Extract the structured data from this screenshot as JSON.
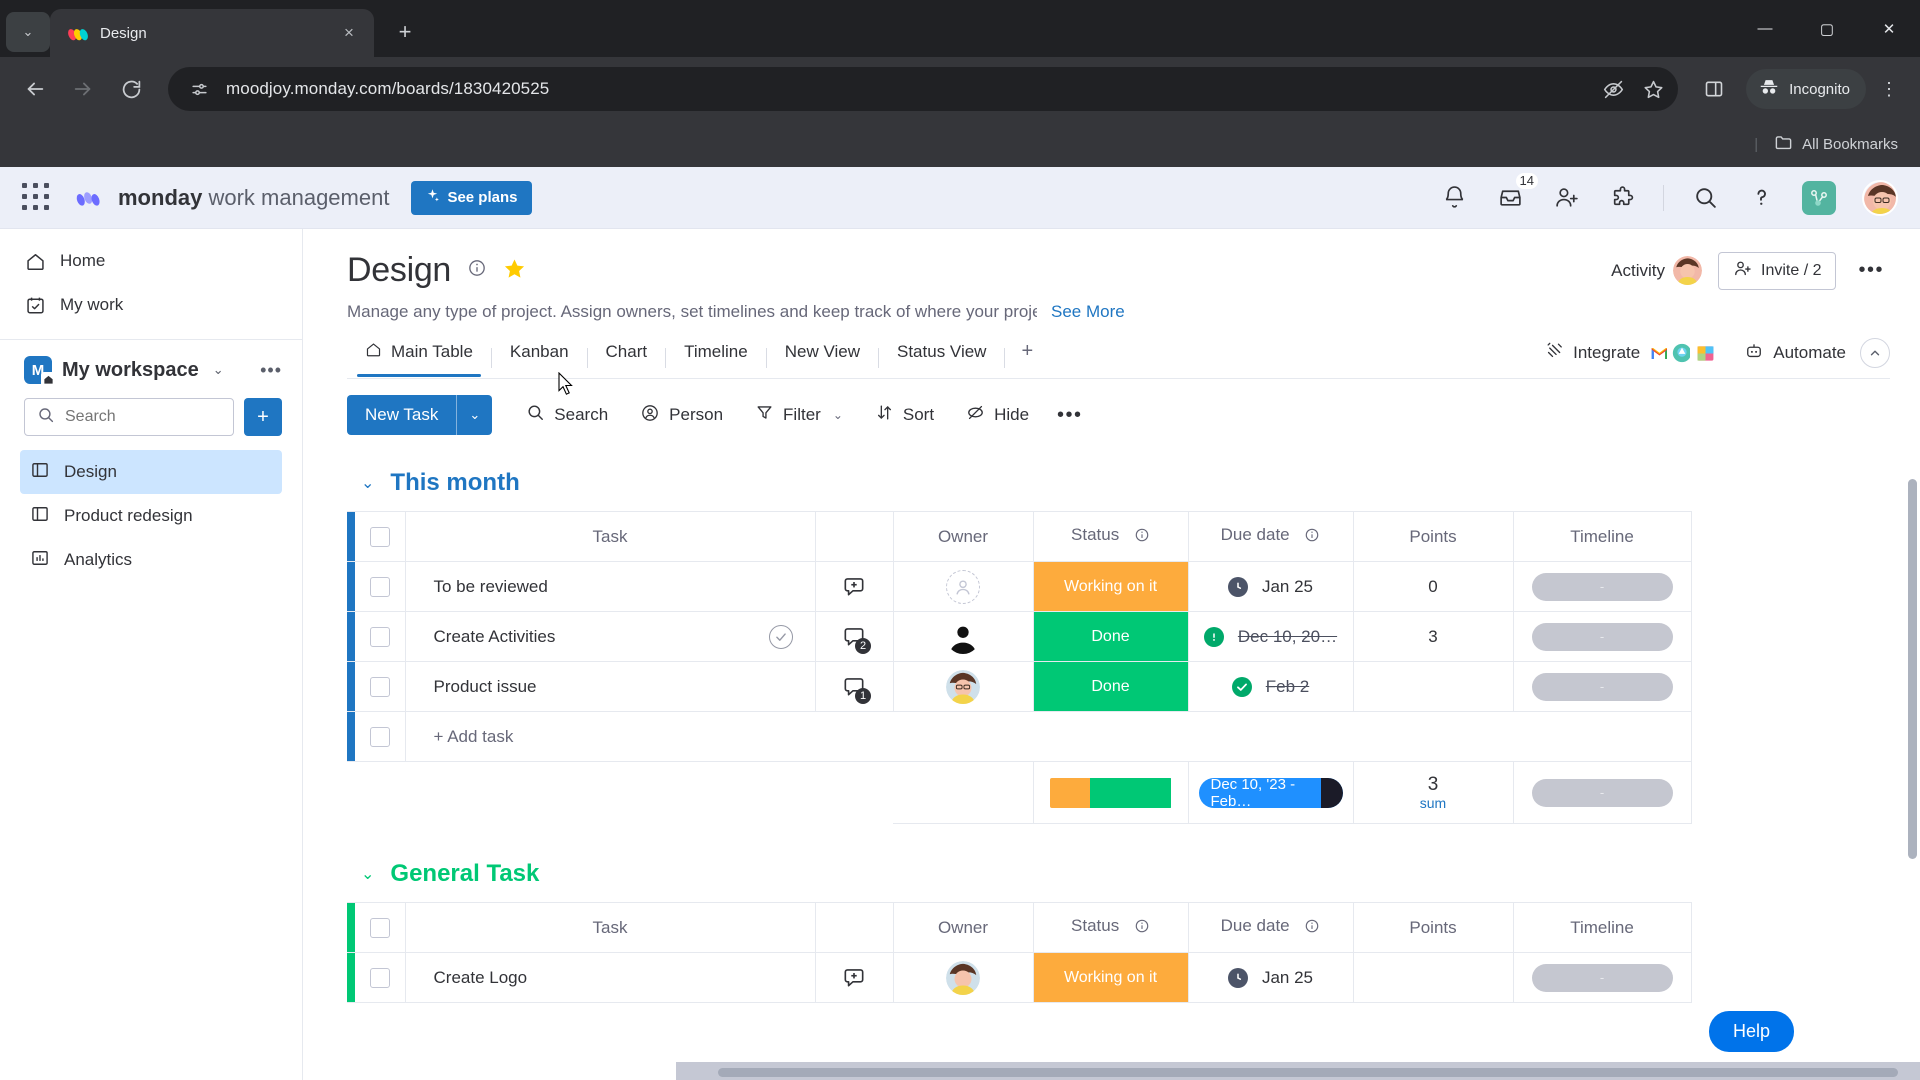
{
  "browser": {
    "tab": {
      "title": "Design",
      "favicon": "monday-favicon",
      "close_label": "×"
    },
    "new_tab_label": "+",
    "tab_list_chevron": "⌄",
    "window": {
      "minimize": "—",
      "maximize": "▢",
      "close": "✕"
    },
    "nav": {
      "back": "←",
      "forward": "→",
      "reload": "⟳"
    },
    "omnibox": {
      "url": "moodjoy.monday.com/boards/1830420525",
      "site_info_icon": "page-settings-icon",
      "tracking_icon": "eye-off-icon",
      "bookmark_icon": "star-icon"
    },
    "split_view_icon": "side-panel-icon",
    "incognito_label": "Incognito",
    "menu_icon": "⋮",
    "bookmarks": {
      "separator": "|",
      "all_bookmarks": "All Bookmarks"
    }
  },
  "topbar": {
    "apps_icon": "grid-apps-icon",
    "brand_bold": "monday",
    "brand_light": " work management",
    "see_plans": "See plans",
    "icons": [
      {
        "name": "notifications-bell-icon"
      },
      {
        "name": "inbox-icon",
        "badge": "14"
      },
      {
        "name": "invite-member-icon"
      },
      {
        "name": "apps-marketplace-icon"
      },
      {
        "name": "search-icon"
      },
      {
        "name": "help-question-icon"
      }
    ]
  },
  "sidebar": {
    "nav": [
      {
        "label": "Home",
        "icon": "home-icon"
      },
      {
        "label": "My work",
        "icon": "calendar-check-icon"
      }
    ],
    "workspace": {
      "initial": "M",
      "name": "My workspace",
      "chevron": "⌄",
      "more": "•••"
    },
    "search_placeholder": "Search",
    "add_label": "+",
    "boards": [
      {
        "label": "Design",
        "icon": "board-icon",
        "active": true
      },
      {
        "label": "Product redesign",
        "icon": "board-icon",
        "active": false
      },
      {
        "label": "Analytics",
        "icon": "dashboard-chart-icon",
        "active": false
      }
    ]
  },
  "board": {
    "title": "Design",
    "info_icon": "info-icon",
    "favorite_icon": "star-filled-icon",
    "description": "Manage any type of project. Assign owners, set timelines and keep track of where your projec…",
    "see_more": "See More",
    "activity_label": "Activity",
    "invite_label": "Invite / 2",
    "more_label": "•••",
    "tabs": [
      {
        "label": "Main Table",
        "icon": "home-icon",
        "active": true
      },
      {
        "label": "Kanban",
        "active": false
      },
      {
        "label": "Chart",
        "active": false
      },
      {
        "label": "Timeline",
        "active": false
      },
      {
        "label": "New View",
        "active": false
      },
      {
        "label": "Status View",
        "active": false
      }
    ],
    "add_view": "+",
    "integrate_label": "Integrate",
    "integrate_apps": [
      "gmail-icon",
      "slack-icon",
      "google-drive-icon"
    ],
    "automate_label": "Automate",
    "collapse_icon": "chevron-up-icon"
  },
  "toolbar": {
    "new_task": "New Task",
    "new_task_chevron": "⌄",
    "items": [
      {
        "label": "Search",
        "icon": "search-icon"
      },
      {
        "label": "Person",
        "icon": "person-icon"
      },
      {
        "label": "Filter",
        "icon": "filter-icon",
        "chevron": "⌄"
      },
      {
        "label": "Sort",
        "icon": "sort-icon"
      },
      {
        "label": "Hide",
        "icon": "hide-eye-icon"
      }
    ],
    "more": "•••"
  },
  "table": {
    "columns": [
      "Task",
      "Owner",
      "Status",
      "Due date",
      "Points",
      "Timeline"
    ],
    "add_task_label": "+ Add task",
    "groups": [
      {
        "name": "This month",
        "color": "#1f76c2",
        "chevron": "⌄",
        "rows": [
          {
            "task": "To be reviewed",
            "has_check": false,
            "conversations": "",
            "owner": "none",
            "status": "Working on it",
            "status_color": "#fdab3d",
            "due_date": "Jan 25",
            "due_icon": "clock-dark-icon",
            "due_strike": false,
            "points": "0",
            "timeline": "-"
          },
          {
            "task": "Create Activities",
            "has_check": true,
            "conversations": "2",
            "owner": "avatar-dark",
            "status": "Done",
            "status_color": "#00c875",
            "due_date": "Dec 10, 20…",
            "due_icon": "alert-green-icon",
            "due_strike": true,
            "points": "3",
            "timeline": "-"
          },
          {
            "task": "Product issue",
            "has_check": false,
            "conversations": "1",
            "owner": "avatar-woman",
            "status": "Done",
            "status_color": "#00c875",
            "due_date": "Feb 2",
            "due_icon": "check-green-icon",
            "due_strike": true,
            "points": "",
            "timeline": "-"
          }
        ],
        "summary": {
          "status_segments": [
            {
              "color": "#fdab3d",
              "pct": 33.3
            },
            {
              "color": "#00c875",
              "pct": 66.7
            }
          ],
          "date_range": "Dec 10, '23 - Feb…",
          "points_value": "3",
          "points_label": "sum",
          "timeline": "-"
        }
      },
      {
        "name": "General Task",
        "color": "#00c875",
        "chevron": "⌄",
        "rows": [
          {
            "task": "Create Logo",
            "has_check": false,
            "conversations": "",
            "owner": "avatar-woman",
            "status": "Working on it",
            "status_color": "#fdab3d",
            "due_date": "Jan 25",
            "due_icon": "clock-dark-icon",
            "due_strike": false,
            "points": "",
            "timeline": "-"
          }
        ]
      }
    ]
  },
  "help_button": "Help",
  "colors": {
    "accent_blue": "#1f76c2",
    "status_working": "#fdab3d",
    "status_done": "#00c875",
    "sidebar_active": "#cce5ff"
  }
}
